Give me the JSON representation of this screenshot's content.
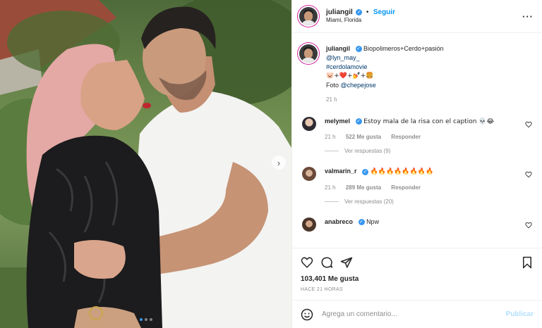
{
  "post": {
    "username": "juliangil",
    "follow_label": "Seguir",
    "separator": "•",
    "location": "Miami, Florida",
    "more_label": "···"
  },
  "caption": {
    "username": "juliangil",
    "text": "Biopolimeros+Cerdo+pasión",
    "mention": "@lyn_may_",
    "hashtag": "#cerdolamovie",
    "emoji_line": "🐷+❤️+💅+🍔",
    "photo_prefix": "Foto",
    "photo_credit": "@chepejose",
    "time": "21 h"
  },
  "comments": [
    {
      "username": "melymel",
      "text": "Estoy mala de la risa con el caption 💀😂",
      "time": "21 h",
      "likes": "522 Me gusta",
      "reply_label": "Responder",
      "view_replies": "Ver respuestas (9)"
    },
    {
      "username": "valmarin_r",
      "text": "🔥🔥🔥🔥🔥🔥🔥🔥",
      "time": "21 h",
      "likes": "289 Me gusta",
      "reply_label": "Responder",
      "view_replies": "Ver respuestas (20)"
    },
    {
      "username": "anabreco",
      "text": "Npw",
      "time": "",
      "likes": "",
      "reply_label": "",
      "view_replies": ""
    }
  ],
  "stats": {
    "likes": "103,401 Me gusta",
    "when": "HACE 21 HORAS"
  },
  "composer": {
    "placeholder": "Agrega un comentario...",
    "publish_label": "Publicar"
  },
  "carousel": {
    "next_icon": "chevron-right-icon",
    "current": 1,
    "total": 3
  },
  "icons": {
    "verified": "verified-badge-icon",
    "like": "heart-icon",
    "comment": "comment-icon",
    "share": "share-icon",
    "save": "bookmark-icon",
    "emoji": "emoji-icon"
  },
  "colors": {
    "accent": "#0095f6",
    "verified": "#3897f0",
    "muted": "#8e8e8e",
    "publish_disabled": "#b2dffc"
  }
}
